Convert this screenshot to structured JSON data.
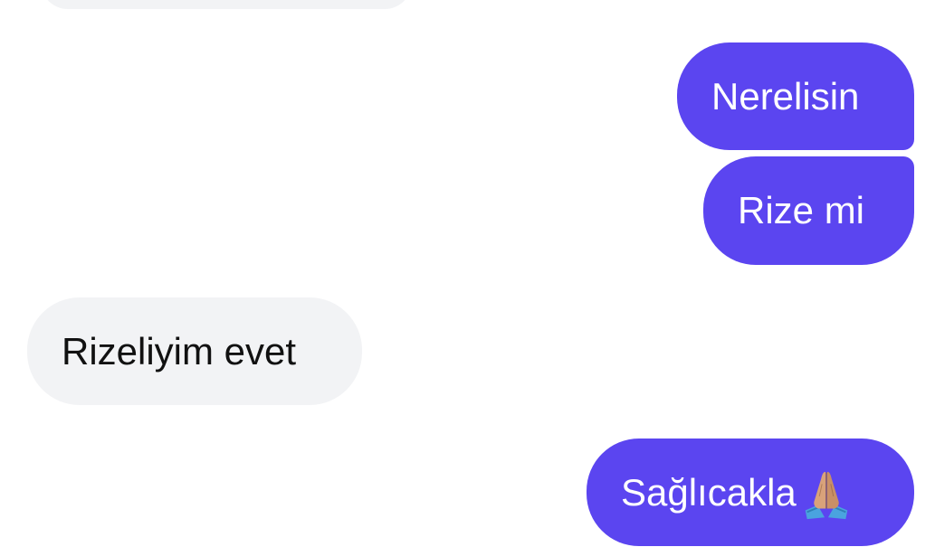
{
  "conversation": {
    "messages": [
      {
        "direction": "incoming",
        "text": ""
      },
      {
        "direction": "outgoing",
        "text": "Nerelisin"
      },
      {
        "direction": "outgoing",
        "text": "Rize mi"
      },
      {
        "direction": "incoming",
        "text": "Rizeliyim evet"
      },
      {
        "direction": "outgoing",
        "text": "Sağlıcakla",
        "emoji": "folded-hands-icon"
      }
    ]
  },
  "colors": {
    "outgoing_bubble": "#5b45f0",
    "incoming_bubble": "#f2f3f5",
    "background": "#ffffff"
  }
}
